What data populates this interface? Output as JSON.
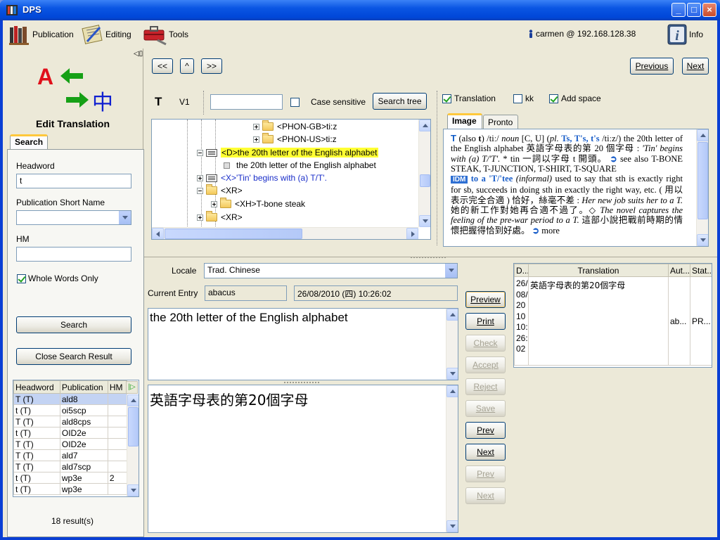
{
  "window": {
    "title": "DPS",
    "minimize": "_",
    "maximize": "□",
    "close": "×"
  },
  "menubar": {
    "publication": "Publication",
    "editing": "Editing",
    "tools": "Tools",
    "user": "carmen @ 192.168.128.38",
    "info": "Info"
  },
  "left": {
    "logo_a": "A",
    "logo_zh": "中",
    "title": "Edit Translation",
    "collapse_glyph": "◁▯",
    "search_tab": "Search",
    "headword_label": "Headword",
    "headword_value": "t",
    "pub_label": "Publication Short Name",
    "pub_value": "",
    "hm_label": "HM",
    "hm_value": "",
    "whole_words_label": "Whole Words Only",
    "search_button": "Search",
    "close_button": "Close Search Result",
    "results_label": "18 result(s)",
    "table": {
      "headers": [
        "Headword",
        "Publication",
        "HM"
      ],
      "rows": [
        {
          "headword": "T (T)",
          "publication": "ald8",
          "hm": ""
        },
        {
          "headword": "t (T)",
          "publication": "oi5scp",
          "hm": ""
        },
        {
          "headword": "T (T)",
          "publication": "ald8cps",
          "hm": ""
        },
        {
          "headword": "t (T)",
          "publication": "OID2e",
          "hm": ""
        },
        {
          "headword": "T (T)",
          "publication": "OID2e",
          "hm": ""
        },
        {
          "headword": "T (T)",
          "publication": "ald7",
          "hm": ""
        },
        {
          "headword": "T (T)",
          "publication": "ald7scp",
          "hm": ""
        },
        {
          "headword": "t (T)",
          "publication": "wp3e",
          "hm": "2"
        },
        {
          "headword": "t (T)",
          "publication": "wp3e",
          "hm": ""
        }
      ]
    }
  },
  "nav": {
    "first": "<<",
    "up": "^",
    "last": ">>",
    "previous": "Previous",
    "next": "Next"
  },
  "entry_bar": {
    "headword": "T",
    "version": "V1",
    "search_value": "",
    "case_sensitive": "Case sensitive",
    "search_tree": "Search tree"
  },
  "tree": {
    "rows": [
      {
        "text": "<PHON-GB>ti:z",
        "kind": "folder"
      },
      {
        "text": "<PHON-US>ti:z",
        "kind": "folder"
      },
      {
        "text": "<D>the 20th letter of the English alphabet",
        "kind": "doc"
      },
      {
        "text": "the 20th letter of the English alphabet",
        "kind": "leaf"
      },
      {
        "text": "<X>'Tin' begins with (a) T/T'.",
        "kind": "doc"
      },
      {
        "text": "<XR>",
        "kind": "folder"
      },
      {
        "text": "<XH>T-bone steak",
        "kind": "folder"
      },
      {
        "text": "<XR>",
        "kind": "folder"
      }
    ]
  },
  "options": {
    "translation": "Translation",
    "kk": "kk",
    "add_space": "Add space"
  },
  "preview_tabs": {
    "image": "Image",
    "pronto": "Pronto"
  },
  "dict": {
    "hw": "T",
    "p1": "(also",
    "t": "t",
    "p2": ") /tiː/",
    "noun": "noun",
    "p3": "[C, U] (",
    "pl": "pl.",
    "forms": "Ts, T's, t's",
    "p4": "/tiːz/) the 20th letter of the English alphabet 英語字母表的第 20 個字母 :",
    "ex1": "'Tin' begins with (a) T/'T'.",
    "p5": "* tin 一詞以字母 t 開頭。",
    "see": "see also",
    "refs": "T-BONE STEAK, T-JUNCTION, T-SHIRT, T-SQUARE",
    "idm": "IDM",
    "idm_phrase": "to a 'T/'tee",
    "informal": "(informal)",
    "p6": "used to say that sth is exactly right for sb, succeeds in doing sth in exactly the right way, etc. ( 用以表示完全合適 ) 恰好，絲毫不差 :",
    "ex2": "Her new job suits her to a T.",
    "p7": "她的新工作對她再合適不過了。◇",
    "ex3": "The novel captures the feeling of the pre-war period to a T.",
    "p8": "這部小說把戰前時期的情懷把握得恰到好處。",
    "more": "more"
  },
  "edit": {
    "locale_label": "Locale",
    "locale_value": "Trad. Chinese",
    "current_entry_label": "Current Entry",
    "current_entry_value": "abacus",
    "timestamp": "26/08/2010 (四) 10:26:02",
    "source_text": "the 20th letter of the English alphabet",
    "translation_text": "英語字母表的第20個字母"
  },
  "actions": {
    "preview": "Preview",
    "print": "Print",
    "check": "Check",
    "accept": "Accept",
    "reject": "Reject",
    "save": "Save",
    "prev": "Prev",
    "next": "Next",
    "prev2": "Prev",
    "next2": "Next"
  },
  "history": {
    "headers": [
      "D...",
      "Translation",
      "Aut...",
      "Stat..."
    ],
    "date_lines": [
      "26/",
      "08/",
      "20",
      "10",
      "10:",
      "26:",
      "02"
    ],
    "translation": "英語字母表的第20個字母",
    "author": "ab...",
    "status": "PR..."
  },
  "colors": {
    "titlebar": "#0a55e3",
    "window_bg": "#ece9d8",
    "highlight": "#ffff33",
    "link_blue": "#1a5ec9",
    "logo_red": "#e0101a",
    "logo_green": "#16a016",
    "logo_blue": "#1020d0"
  }
}
